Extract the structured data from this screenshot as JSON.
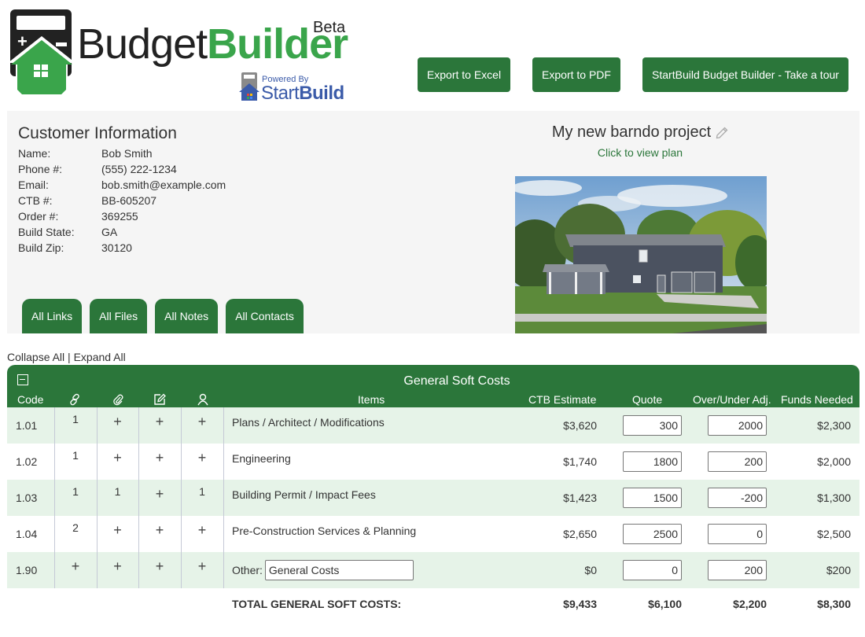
{
  "header": {
    "logo_word_1": "Budget",
    "logo_word_2": "Builder",
    "logo_badge": "Beta",
    "powered_by": "Powered By",
    "powered_brand_1": "Start",
    "powered_brand_2": "Build",
    "buttons": {
      "export_excel": "Export to Excel",
      "export_pdf": "Export to PDF",
      "tour": "StartBuild Budget Builder - Take a tour"
    }
  },
  "customer": {
    "title": "Customer Information",
    "fields": [
      {
        "label": "Name:",
        "value": "Bob Smith"
      },
      {
        "label": "Phone #:",
        "value": "(555) 222-1234"
      },
      {
        "label": "Email:",
        "value": "bob.smith@example.com"
      },
      {
        "label": "CTB #:",
        "value": "BB-605207"
      },
      {
        "label": "Order #:",
        "value": "369255"
      },
      {
        "label": "Build State:",
        "value": "GA"
      },
      {
        "label": "Build Zip:",
        "value": "30120"
      }
    ],
    "tabs": [
      "All Links",
      "All Files",
      "All Notes",
      "All Contacts"
    ]
  },
  "project": {
    "title": "My new barndo project",
    "view_plan": "Click to view plan",
    "image_alt": "Barndominium rendering"
  },
  "controls": {
    "collapse_all": "Collapse All",
    "separator": " | ",
    "expand_all": "Expand All"
  },
  "section": {
    "title": "General Soft Costs",
    "columns": {
      "code": "Code",
      "links_icon": "link-icon",
      "files_icon": "paperclip-icon",
      "notes_icon": "edit-note-icon",
      "contacts_icon": "person-icon",
      "items": "Items",
      "ctb_estimate": "CTB Estimate",
      "quote": "Quote",
      "adj": "Over/Under Adj.",
      "funds": "Funds Needed"
    },
    "rows": [
      {
        "code": "1.01",
        "links": "1",
        "files": "+",
        "notes": "+",
        "contacts": "+",
        "item": "Plans / Architect / Modifications",
        "ctb": "$3,620",
        "quote": "300",
        "adj": "2000",
        "funds": "$2,300"
      },
      {
        "code": "1.02",
        "links": "1",
        "files": "+",
        "notes": "+",
        "contacts": "+",
        "item": "Engineering",
        "ctb": "$1,740",
        "quote": "1800",
        "adj": "200",
        "funds": "$2,000"
      },
      {
        "code": "1.03",
        "links": "1",
        "files": "1",
        "notes": "+",
        "contacts": "1",
        "item": "Building Permit / Impact Fees",
        "ctb": "$1,423",
        "quote": "1500",
        "adj": "-200",
        "funds": "$1,300"
      },
      {
        "code": "1.04",
        "links": "2",
        "files": "+",
        "notes": "+",
        "contacts": "+",
        "item": "Pre-Construction Services & Planning",
        "ctb": "$2,650",
        "quote": "2500",
        "adj": "0",
        "funds": "$2,500"
      },
      {
        "code": "1.90",
        "links": "+",
        "files": "+",
        "notes": "+",
        "contacts": "+",
        "item_label": "Other:",
        "item_input": "General Costs",
        "ctb": "$0",
        "quote": "0",
        "adj": "200",
        "funds": "$200"
      }
    ],
    "totals": {
      "label": "TOTAL GENERAL SOFT COSTS:",
      "ctb": "$9,433",
      "quote": "$6,100",
      "adj": "$2,200",
      "funds": "$8,300"
    }
  },
  "colors": {
    "brand_green": "#2b763a",
    "logo_green": "#3aa54b",
    "row_alt": "#e6f3e8",
    "panel_bg": "#f5f5f5",
    "startbuild_blue": "#3b5ba9"
  }
}
